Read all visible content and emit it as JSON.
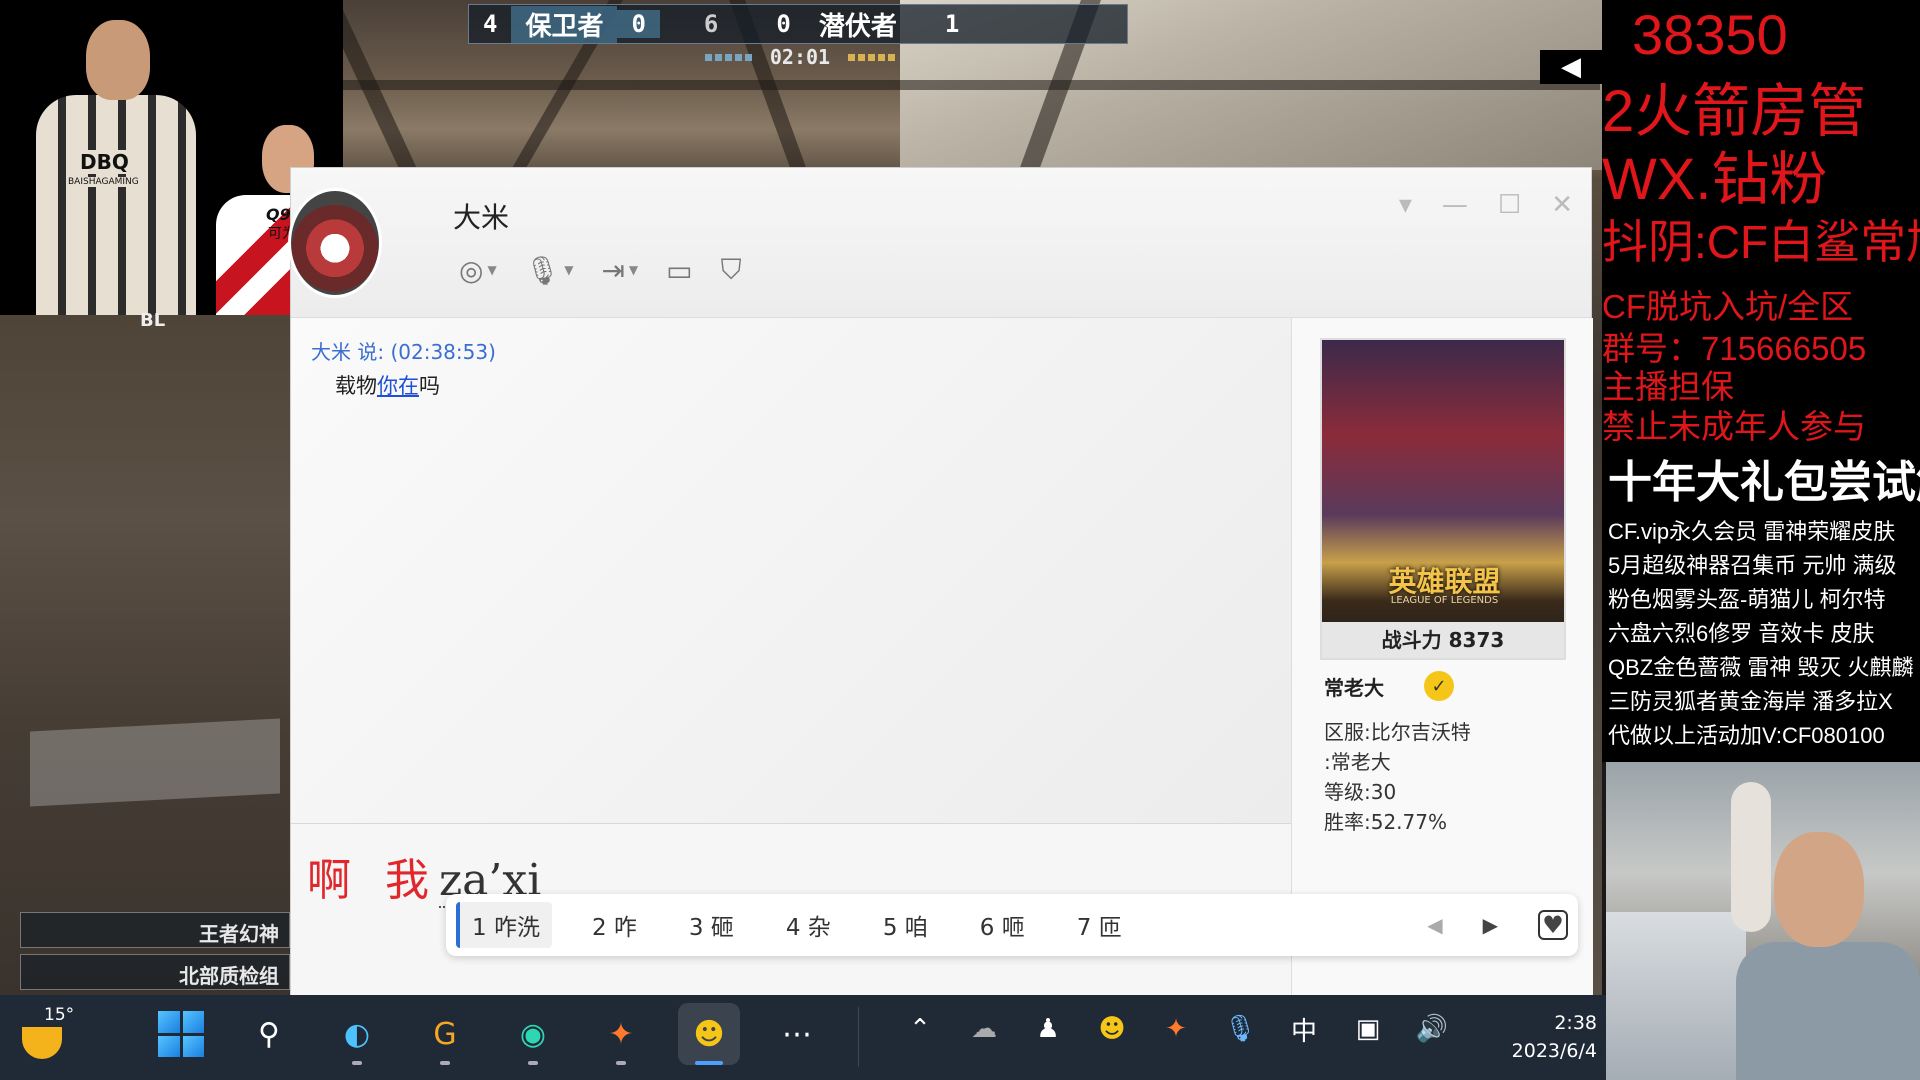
{
  "game": {
    "score": {
      "left_kills": "4",
      "left_team": "保卫者",
      "left_rounds": "0",
      "round_target": "6",
      "right_rounds": "0",
      "right_team": "潜伏者",
      "right_kills": "1"
    },
    "timer": "02:01",
    "kill_feed": [
      "王者幻神",
      "北部质检组"
    ],
    "cut_text": "BL"
  },
  "webcam_top": {
    "jersey_label": "DBQ",
    "jersey_sub": "BAISHAGAMING",
    "jersey2_num": "Q9",
    "jersey2_name": "可为"
  },
  "chat": {
    "contact_name": "大米",
    "toolbar": [
      "video-call",
      "voice-call",
      "file-transfer",
      "screen-share",
      "report"
    ],
    "window_controls": [
      "▾",
      "—",
      "☐",
      "✕"
    ],
    "message": {
      "meta": "大米 说: (02:38:53)",
      "text_before": "载物",
      "link": "你在",
      "text_after": "吗"
    },
    "input": {
      "committed": "啊 我",
      "pinyin": "za’xi"
    },
    "ime_candidates": [
      "1 咋洗",
      "2 咋",
      "3 砸",
      "4 杂",
      "5 咱",
      "6 咂",
      "7 匝"
    ],
    "profile": {
      "poster_logo": "英雄联盟",
      "poster_logo_sub": "LEAGUE OF LEGENDS",
      "power_label": "战斗力 8373",
      "name": "常老大",
      "server": "区服:比尔吉沃特",
      "role": ":常老大",
      "level": "等级:30",
      "win_rate": "胜率:52.77%"
    }
  },
  "overlay": {
    "line1": "38350",
    "line2": "2火箭房管",
    "line3": "WX.钻粉",
    "line4": "抖阴:CF白鲨常旭",
    "line5": "CF脱坑入坑/全区",
    "line6": "群号：715666505",
    "line7": "主播担保",
    "line8": "禁止未成年人参与",
    "headline": "十年大礼包尝试解封",
    "items": [
      "CF.vip永久会员 雷神荣耀皮肤",
      "5月超级神器召集币 元帅 满级",
      "粉色烟雾头盔-萌猫儿 柯尔特",
      "六盘六烈6修罗 音效卡 皮肤",
      "QBZ金色蔷薇 雷神 毁灭 火麒麟",
      "三防灵狐者黄金海岸 潘多拉X",
      "代做以上活动加V:CF080100"
    ]
  },
  "taskbar": {
    "temperature": "15°",
    "time": "2:38",
    "date": "2023/6/4",
    "ime_lang": "中",
    "colors": {
      "bg": "#1f2a36",
      "accent": "#4ca0ff"
    }
  }
}
